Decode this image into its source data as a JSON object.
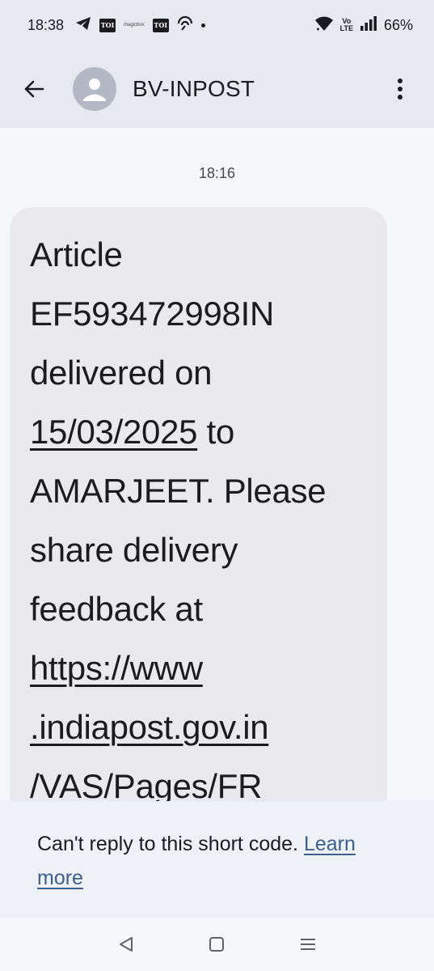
{
  "status_bar": {
    "time": "18:38",
    "mini_label": "magicbox",
    "toi_label": "TOI",
    "volte_top": "Vo",
    "volte_bottom": "LTE",
    "battery": "66%"
  },
  "header": {
    "title": "BV-INPOST"
  },
  "conversation": {
    "timestamp": "18:16",
    "message": {
      "line1": "Article",
      "line2": "EF593472998IN",
      "line3": "delivered on",
      "date": "15/03/2025",
      "line4_rest": " to",
      "line5": "AMARJEET. Please",
      "line6": "share delivery",
      "line7": "feedback at",
      "url_line1": "https://www",
      "url_line2": ".indiapost.gov.in",
      "url_line3": "/VAS/Pages/FR"
    }
  },
  "notice": {
    "text": "Can't reply to this short code. ",
    "link": "Learn more"
  },
  "icons": {
    "back": "arrow-back-icon",
    "avatar": "person-icon",
    "more": "more-vert-icon",
    "nav_back": "nav-back-icon",
    "nav_home": "nav-home-icon",
    "nav_recents": "nav-recents-icon"
  },
  "colors": {
    "header_bg": "#e6eaf0",
    "bubble_bg": "#e9e9ee",
    "link": "#3d5f8e"
  }
}
